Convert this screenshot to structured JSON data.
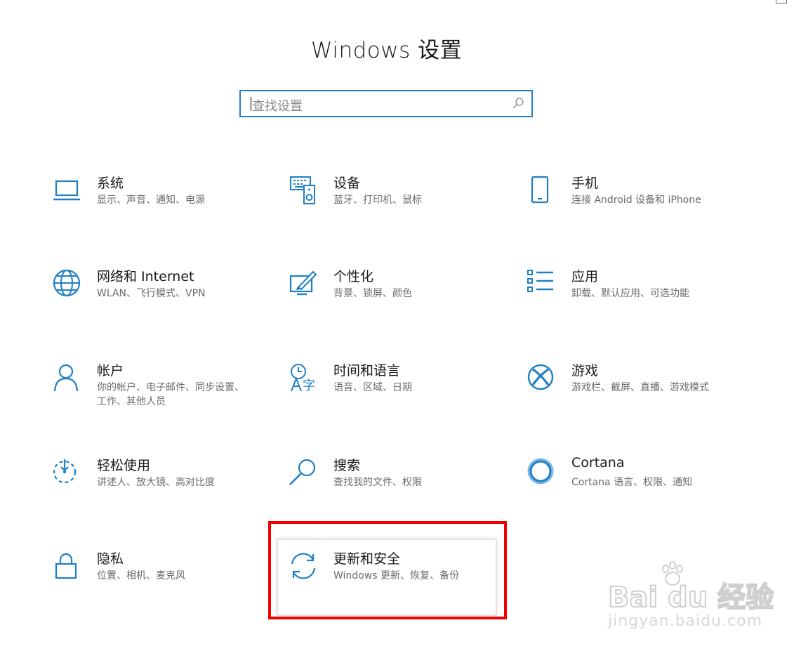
{
  "window": {
    "title": "Windows 设置"
  },
  "search": {
    "placeholder": "查找设置"
  },
  "accent": "#1f7fc4",
  "highlight_color": "#f00000",
  "tiles": [
    {
      "icon": "laptop-icon",
      "title": "系统",
      "desc": "显示、声音、通知、电源"
    },
    {
      "icon": "keyboard-speaker-icon",
      "title": "设备",
      "desc": "蓝牙、打印机、鼠标"
    },
    {
      "icon": "phone-icon",
      "title": "手机",
      "desc": "连接 Android 设备和 iPhone"
    },
    {
      "icon": "globe-icon",
      "title": "网络和 Internet",
      "desc": "WLAN、飞行模式、VPN"
    },
    {
      "icon": "paint-brush-icon",
      "title": "个性化",
      "desc": "背景、锁屏、颜色"
    },
    {
      "icon": "apps-list-icon",
      "title": "应用",
      "desc": "卸载、默认应用、可选功能"
    },
    {
      "icon": "person-icon",
      "title": "帐户",
      "desc": "你的帐户、电子邮件、同步设置、工作、其他人员"
    },
    {
      "icon": "time-language-icon",
      "title": "时间和语言",
      "desc": "语音、区域、日期"
    },
    {
      "icon": "xbox-icon",
      "title": "游戏",
      "desc": "游戏栏、截屏、直播、游戏模式"
    },
    {
      "icon": "ease-of-access-icon",
      "title": "轻松使用",
      "desc": "讲述人、放大镜、高对比度"
    },
    {
      "icon": "search-icon",
      "title": "搜索",
      "desc": "查找我的文件、权限"
    },
    {
      "icon": "cortana-icon",
      "title": "Cortana",
      "desc": "Cortana 语言、权限、通知"
    },
    {
      "icon": "lock-icon",
      "title": "隐私",
      "desc": "位置、相机、麦克风"
    },
    {
      "icon": "refresh-icon",
      "title": "更新和安全",
      "desc": "Windows 更新、恢复、备份"
    }
  ],
  "watermark": {
    "brand": "Bai du 经验",
    "url": "jingyan.baidu.com"
  }
}
